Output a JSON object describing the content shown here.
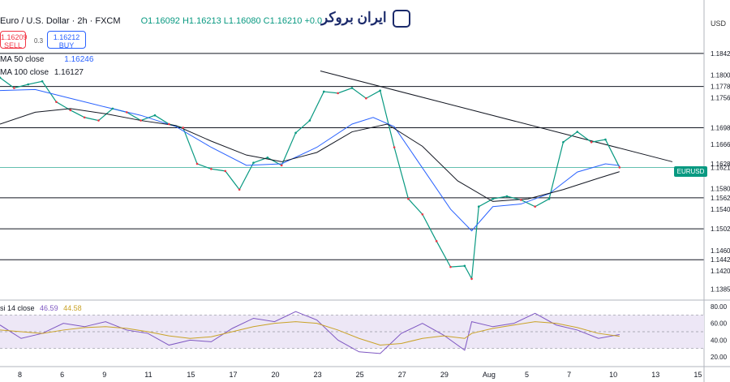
{
  "header": {
    "symbol": "Euro / U.S. Dollar · 2h · FXCM",
    "ohlc": "O1.16092 H1.16213 L1.16080 C1.16210 +0.0"
  },
  "trade": {
    "sell_price": "1.16209",
    "sell_label": "SELL",
    "spread": "0.3",
    "buy_price": "1.16212",
    "buy_label": "BUY"
  },
  "indicators": {
    "ma50": "MA 50 close",
    "ma50_value": "1.16246",
    "ma100": "MA 100 close",
    "ma100_value": "1.16127"
  },
  "logo_text": "ایران بروکر",
  "currency": "USD",
  "last_badge": "EURUSD",
  "rsi": {
    "label": "si 14 close",
    "value": "46.59",
    "ma_value": "44.58"
  },
  "colors": {
    "up": "#089981",
    "down": "#f23645",
    "ma50": "#2962ff",
    "ma100": "#131722",
    "rsi": "#7e57c2",
    "rsi_ma": "#c9a227",
    "rsi_band": "#ede7f6"
  },
  "chart_data": {
    "type": "line",
    "title": "",
    "ylim": [
      1.137,
      1.1845
    ],
    "y_ticks": [
      "1.1842",
      "1.1800",
      "1.1778",
      "1.1756",
      "1.1698",
      "1.1666",
      "1.1628",
      "1.1621",
      "1.1580",
      "1.1562",
      "1.1540",
      "1.1502",
      "1.1460",
      "1.1442",
      "1.1420",
      "1.1385"
    ],
    "x_ticks": [
      "8",
      "6",
      "9",
      "11",
      "15",
      "17",
      "20",
      "23",
      "25",
      "27",
      "29",
      "Aug",
      "5",
      "7",
      "10",
      "13",
      "15"
    ],
    "horizontal_levels": [
      1.1842,
      1.1778,
      1.1698,
      1.1562,
      1.1502,
      1.1442
    ],
    "trendline": {
      "from": {
        "x": 0.455,
        "y": 1.1808
      },
      "to": {
        "x": 0.955,
        "y": 1.1632
      }
    },
    "series": [
      {
        "name": "",
        "x": [
          0,
          0.02,
          0.04,
          0.06,
          0.08,
          0.1,
          0.12,
          0.14,
          0.16,
          0.18,
          0.2,
          0.22,
          0.24,
          0.26,
          0.28,
          0.3,
          0.32,
          0.34,
          0.36,
          0.38,
          0.4,
          0.42,
          0.44,
          0.46,
          0.48,
          0.5,
          0.52,
          0.54,
          0.56,
          0.58,
          0.6,
          0.62,
          0.64,
          0.66,
          0.67,
          0.68,
          0.7,
          0.72,
          0.74,
          0.76,
          0.78,
          0.8,
          0.82,
          0.84,
          0.86,
          0.88
        ],
        "values": [
          1.1795,
          1.1775,
          1.1782,
          1.1788,
          1.1748,
          1.1732,
          1.1718,
          1.1712,
          1.1735,
          1.1728,
          1.1712,
          1.1722,
          1.1705,
          1.1698,
          1.1628,
          1.1618,
          1.1614,
          1.1578,
          1.163,
          1.164,
          1.1625,
          1.1688,
          1.1712,
          1.1768,
          1.1765,
          1.1775,
          1.1755,
          1.177,
          1.166,
          1.156,
          1.153,
          1.1478,
          1.1428,
          1.143,
          1.1405,
          1.1545,
          1.156,
          1.1565,
          1.1558,
          1.1545,
          1.156,
          1.167,
          1.169,
          1.167,
          1.1675,
          1.1621
        ]
      },
      {
        "name": "",
        "x": [
          0,
          0.05,
          0.1,
          0.15,
          0.2,
          0.25,
          0.3,
          0.35,
          0.4,
          0.45,
          0.5,
          0.53,
          0.56,
          0.6,
          0.64,
          0.67,
          0.7,
          0.74,
          0.78,
          0.82,
          0.86,
          0.88
        ],
        "values": [
          1.177,
          1.1772,
          1.1755,
          1.1738,
          1.1722,
          1.17,
          1.166,
          1.1625,
          1.1628,
          1.166,
          1.1705,
          1.1718,
          1.17,
          1.162,
          1.154,
          1.1498,
          1.1545,
          1.155,
          1.157,
          1.1612,
          1.1628,
          1.16246
        ]
      },
      {
        "name": "",
        "x": [
          0,
          0.05,
          0.1,
          0.15,
          0.2,
          0.25,
          0.3,
          0.35,
          0.4,
          0.45,
          0.5,
          0.55,
          0.6,
          0.65,
          0.7,
          0.75,
          0.8,
          0.85,
          0.88
        ],
        "values": [
          1.1705,
          1.1728,
          1.1735,
          1.1725,
          1.1712,
          1.1702,
          1.1672,
          1.1645,
          1.1632,
          1.165,
          1.169,
          1.1705,
          1.1662,
          1.1595,
          1.1555,
          1.156,
          1.1578,
          1.16,
          1.16127
        ]
      }
    ],
    "rsi": {
      "ylim": [
        20,
        80
      ],
      "y_ticks": [
        "80.00",
        "60.00",
        "40.00",
        "20.00"
      ],
      "bands": [
        70,
        50,
        30
      ],
      "x": [
        0,
        0.03,
        0.06,
        0.09,
        0.12,
        0.15,
        0.18,
        0.21,
        0.24,
        0.27,
        0.3,
        0.33,
        0.36,
        0.39,
        0.42,
        0.45,
        0.48,
        0.51,
        0.54,
        0.57,
        0.6,
        0.63,
        0.66,
        0.67,
        0.7,
        0.73,
        0.76,
        0.79,
        0.82,
        0.85,
        0.88
      ],
      "values": [
        58,
        42,
        48,
        60,
        56,
        62,
        52,
        48,
        34,
        40,
        38,
        54,
        66,
        62,
        74,
        64,
        40,
        26,
        24,
        48,
        60,
        46,
        28,
        62,
        56,
        60,
        72,
        58,
        52,
        42,
        46.59
      ],
      "ma": [
        52,
        50,
        48,
        52,
        55,
        56,
        54,
        50,
        45,
        42,
        44,
        50,
        56,
        60,
        62,
        60,
        52,
        42,
        34,
        36,
        42,
        45,
        42,
        48,
        54,
        58,
        62,
        60,
        55,
        48,
        44.58
      ]
    }
  }
}
